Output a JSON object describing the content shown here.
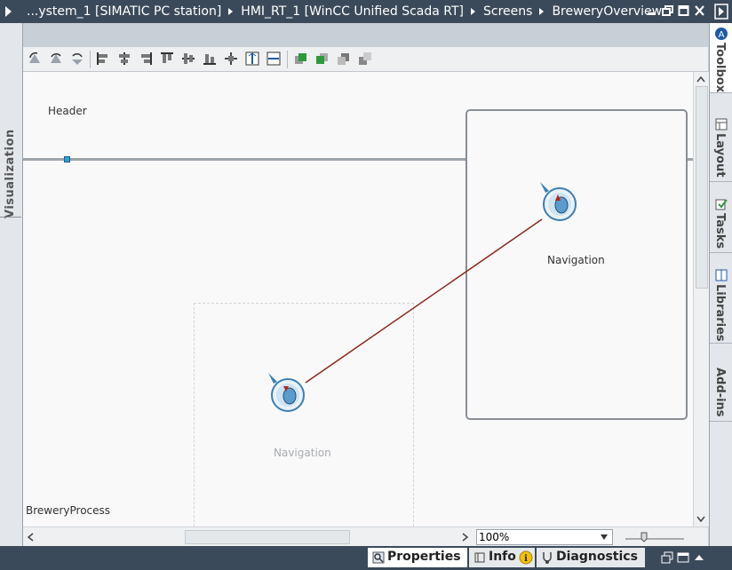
{
  "title_bar": {
    "breadcrumb": [
      "...ystem_1 [SIMATIC PC station]",
      "HMI_RT_1 [WinCC Unified Scada RT]",
      "Screens",
      "BreweryOverview"
    ]
  },
  "left_panel": {
    "label": "Visualization"
  },
  "toolbar": {
    "icons": [
      "rotate-icon",
      "rotate-left-icon",
      "rotate-right-icon",
      "align-left-icon",
      "align-center-icon",
      "align-right-icon",
      "align-top-icon",
      "align-middle-icon",
      "align-bottom-icon",
      "distribute-icon",
      "same-height-icon",
      "same-width-icon",
      "bring-front-icon",
      "bring-forward-icon",
      "send-backward-icon",
      "send-back-icon"
    ]
  },
  "canvas": {
    "header_label": "Header",
    "footer_label": "BreweryProcess",
    "nav_label_active": "Navigation",
    "nav_label_ghost": "Navigation"
  },
  "status": {
    "zoom": "100%"
  },
  "right_panel": {
    "tabs": [
      "Toolbox",
      "Layout",
      "Tasks",
      "Libraries",
      "Add-ins"
    ]
  },
  "bottom_tabs": {
    "properties": "Properties",
    "info": "Info",
    "diagnostics": "Diagnostics"
  },
  "colors": {
    "titlebar": "#3b4a5a",
    "connector": "#8b2a1e",
    "accent": "#1f77b4"
  }
}
